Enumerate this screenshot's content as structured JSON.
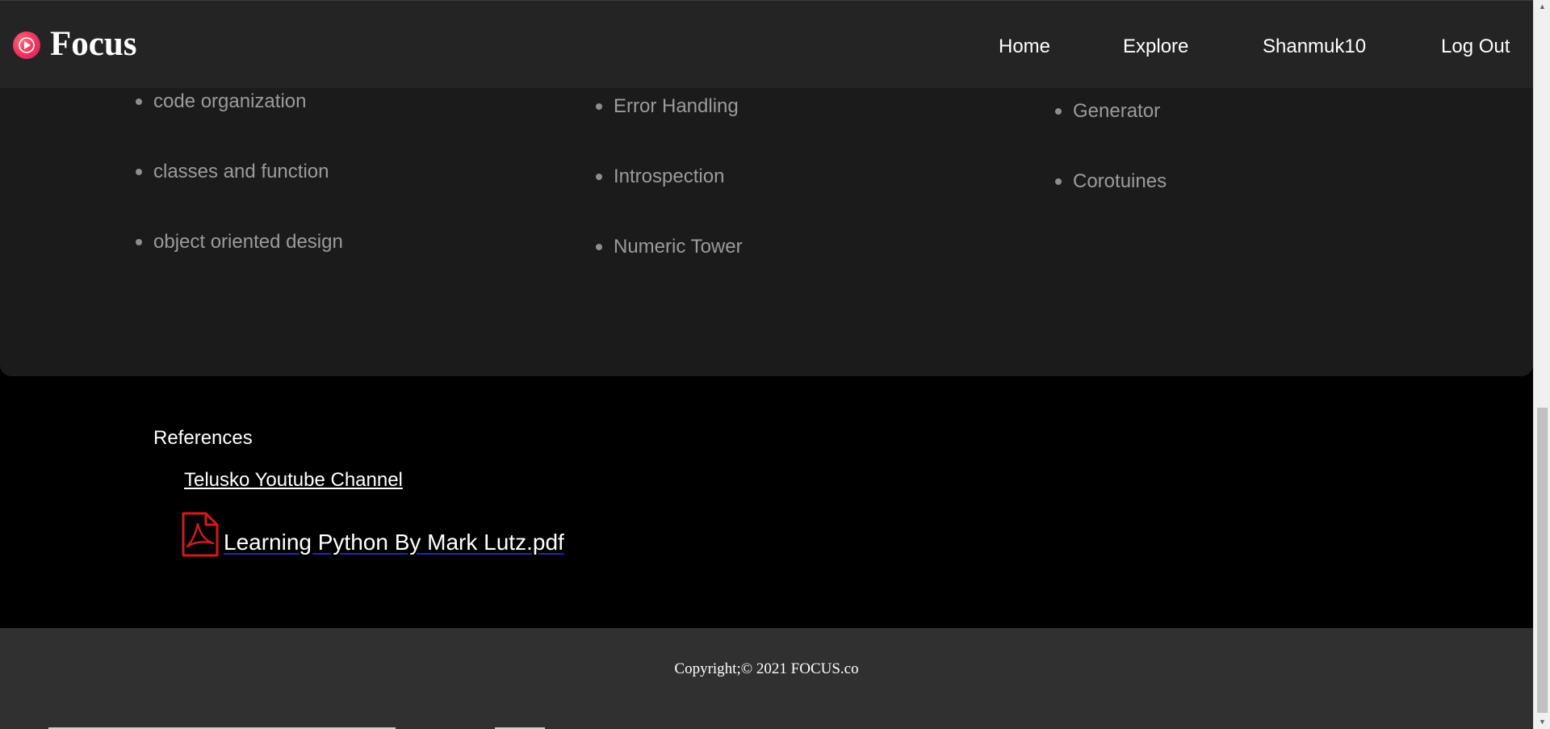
{
  "header": {
    "brand": "Focus",
    "nav": {
      "home": "Home",
      "explore": "Explore",
      "user": "Shanmuk10",
      "logout": "Log Out"
    }
  },
  "topics": {
    "column1": [
      "code organization",
      "classes and function",
      "object oriented design"
    ],
    "column2": [
      "Error Handling",
      "Introspection",
      "Numeric Tower"
    ],
    "column3": [
      "Generator",
      "Corotuines"
    ]
  },
  "references": {
    "title": "References",
    "youtube_link": "Telusko Youtube Channel",
    "pdf_link": "Learning Python By Mark Lutz.pdf"
  },
  "footer": {
    "copyright": "Copyright;© 2021 FOCUS.co"
  },
  "colors": {
    "logo_accent": "#e91e63",
    "pdf_icon": "#d11a1a",
    "header_bg": "#242424",
    "card_bg": "#1b1b1b",
    "footer_bg": "#303030"
  },
  "icons": {
    "logo": "play-circle-icon",
    "pdf": "pdf-file-icon"
  }
}
